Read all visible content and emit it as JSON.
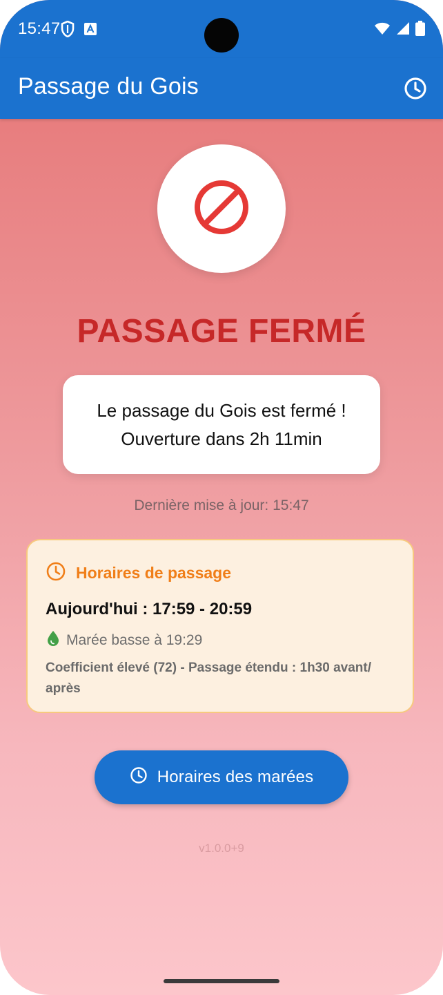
{
  "status_bar": {
    "time": "15:47",
    "left_icons": [
      "shield-icon",
      "translate-a-icon"
    ],
    "right_icons": [
      "wifi-icon",
      "signal-icon",
      "battery-icon"
    ]
  },
  "app_bar": {
    "title": "Passage du Gois",
    "action_icon": "history-clock-icon"
  },
  "status": {
    "icon": "no-entry-icon",
    "headline": "PASSAGE FERMÉ",
    "message_line1": "Le passage du Gois est fermé !",
    "message_line2": "Ouverture dans 2h 11min",
    "last_update": "Dernière mise à jour: 15:47"
  },
  "schedule": {
    "title": "Horaires de passage",
    "today": "Aujourd'hui : 17:59 - 20:59",
    "low_tide": "Marée basse à 19:29",
    "coefficient_note": "Coefficient élevé (72) - Passage étendu : 1h30 avant/ après"
  },
  "tides_button": {
    "label": "Horaires des marées",
    "icon": "clock-icon"
  },
  "version": "v1.0.0+9",
  "colors": {
    "primary": "#1b72cf",
    "closed_red": "#c62828",
    "warning_orange": "#f07e18",
    "card_bg": "#fdf0e0"
  }
}
